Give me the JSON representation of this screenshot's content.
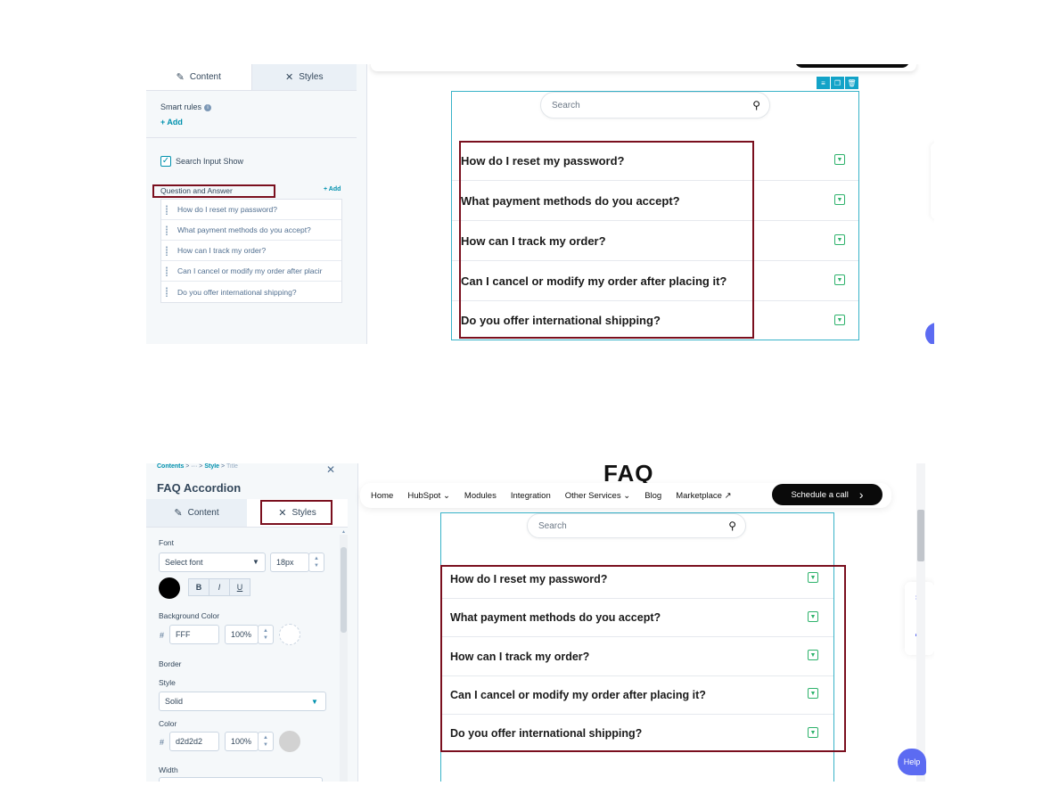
{
  "top": {
    "tabs": {
      "content": "Content",
      "styles": "Styles"
    },
    "smart_rules": {
      "label": "Smart rules",
      "add": "+ Add"
    },
    "search_input_show": "Search Input Show",
    "qa_header": {
      "label": "Question and Answer",
      "add": "+ Add"
    },
    "qa_items": [
      "How do I reset my password?",
      "What payment methods do you accept?",
      "How can I track my order?",
      "Can I cancel or modify my order after placir",
      "Do you offer international shipping?"
    ],
    "search_placeholder": "Search",
    "questions": [
      "How do I reset my password?",
      "What payment methods do you accept?",
      "How can I track my order?",
      "Can I cancel or modify my order after placing it?",
      "Do you offer international shipping?"
    ]
  },
  "bottom": {
    "breadcrumb": {
      "contents": "Contents",
      "sep1": ">",
      "ellipsis": "···",
      "sep2": ">",
      "style": "Style",
      "sep3": ">",
      "title": "Title"
    },
    "panel_title": "FAQ Accordion",
    "tabs": {
      "content": "Content",
      "styles": "Styles"
    },
    "font": {
      "label": "Font",
      "select": "Select font",
      "size": "18px",
      "bold": "B",
      "italic": "I",
      "underline": "U"
    },
    "background": {
      "label": "Background Color",
      "hash": "#",
      "hex": "FFF",
      "opacity": "100%"
    },
    "border": {
      "label": "Border",
      "style_label": "Style",
      "style_value": "Solid",
      "color_label": "Color",
      "hash": "#",
      "hex": "d2d2d2",
      "opacity": "100%",
      "width_label": "Width"
    },
    "nav": [
      "Home",
      "HubSpot ⌄",
      "Modules",
      "Integration",
      "Other Services ⌄",
      "Blog",
      "Marketplace ↗"
    ],
    "cta": {
      "label": "Schedule a call",
      "arrow": "›"
    },
    "heading": "FAQ",
    "search_placeholder": "Search",
    "questions": [
      "How do I reset my password?",
      "What payment methods do you accept?",
      "How can I track my order?",
      "Can I cancel or modify my order after placing it?",
      "Do you offer international shipping?"
    ],
    "help": "Help"
  },
  "colors": {
    "accent": "#0091ae",
    "highlight": "#7a0f1e",
    "toggle": "#2db26b",
    "frame": "#38b2c8",
    "help": "#5c6bf2"
  }
}
